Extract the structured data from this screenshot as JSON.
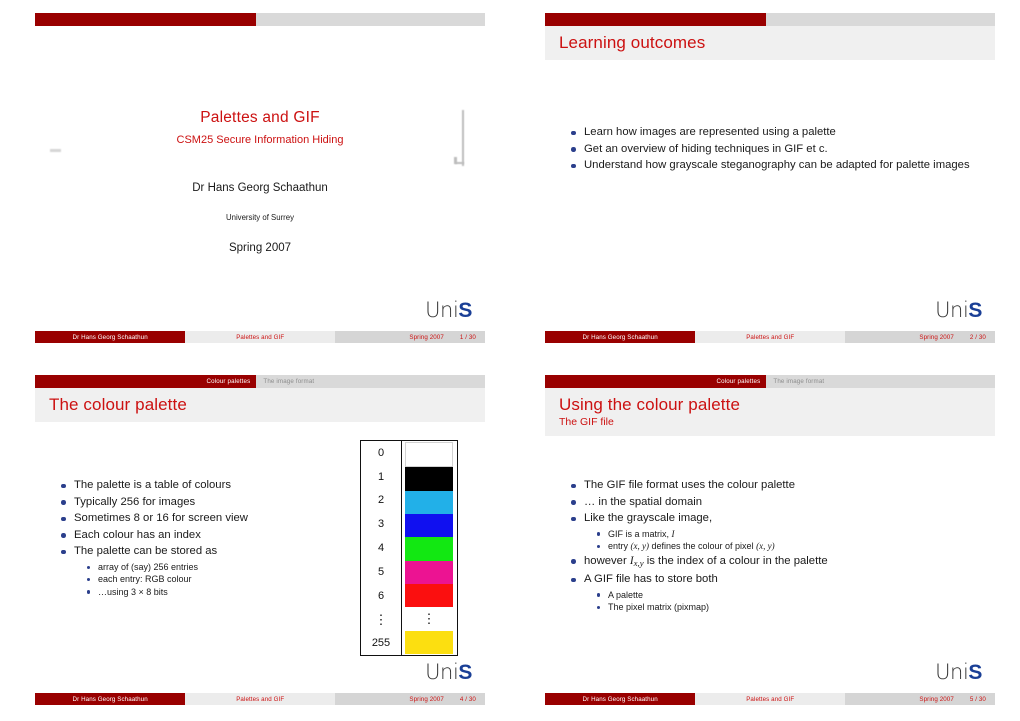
{
  "deck": {
    "author": "Dr Hans Georg Schaathun",
    "short_title": "Palettes and GIF",
    "date": "Spring 2007",
    "total_slides": "30",
    "logo_uni": "Uni",
    "logo_s": "S",
    "accent_red": "#990000",
    "title_red": "#cc1111",
    "bullet_blue": "#2b3f8c",
    "band_gray": "#f0f0f0",
    "nav_gray": "#d9d9d9"
  },
  "slide1": {
    "title": "Palettes and GIF",
    "subtitle": "CSM25 Secure Information Hiding",
    "author": "Dr Hans Georg Schaathun",
    "institute": "University of Surrey",
    "date": "Spring 2007",
    "footer": {
      "author": "Dr Hans Georg Schaathun",
      "title": "Palettes and GIF",
      "date": "Spring 2007",
      "page": "1 / 30"
    }
  },
  "slide2": {
    "title": "Learning outcomes",
    "bullets": [
      "Learn how images are represented using a palette",
      "Get an overview of hiding techniques in GIF et c.",
      "Understand how grayscale steganography can be adapted for palette images"
    ],
    "footer": {
      "author": "Dr Hans Georg Schaathun",
      "title": "Palettes and GIF",
      "date": "Spring 2007",
      "page": "2 / 30"
    }
  },
  "slide3": {
    "nav": {
      "active": "Colour palettes",
      "inactive": "The image format"
    },
    "title": "The colour palette",
    "bullets": [
      "The palette is a table of colours",
      "Typically 256 for images",
      "Sometimes 8 or 16 for screen view",
      "Each colour has an index",
      "The palette can be stored as"
    ],
    "subbullets": [
      "array of (say) 256 entries",
      "each entry: RGB colour",
      "…using 3 × 8 bits"
    ],
    "palette_figure": {
      "indices": [
        "0",
        "1",
        "2",
        "3",
        "4",
        "5",
        "6",
        "⋮",
        "255"
      ],
      "colours": [
        "#ffffff",
        "#000000",
        "#22b0e8",
        "#1010f0",
        "#12e812",
        "#ec1392",
        "#fb0f0f",
        "",
        "#fcdf10"
      ]
    },
    "footer": {
      "author": "Dr Hans Georg Schaathun",
      "title": "Palettes and GIF",
      "date": "Spring 2007",
      "page": "4 / 30"
    }
  },
  "slide4": {
    "nav": {
      "active": "Colour palettes",
      "inactive": "The image format"
    },
    "title": "Using the colour palette",
    "subtitle": "The GIF file",
    "bullets": {
      "b1": "The GIF file format uses the colour palette",
      "b2": "… in the spatial domain",
      "b3": "Like the grayscale image,",
      "b3s1_pre": "GIF is a matrix, ",
      "b3s1_math": "I",
      "b3s2_pre": "entry ",
      "b3s2_xy1": "(x, y)",
      "b3s2_mid": " defines the colour of pixel ",
      "b3s2_xy2": "(x, y)",
      "b4_pre": "however ",
      "b4_sym": "I",
      "b4_sub": "x,y",
      "b4_post": " is the index of a colour in the palette",
      "b5": "A GIF file has to store both",
      "b5s1": "A palette",
      "b5s2": "The pixel matrix (pixmap)"
    },
    "footer": {
      "author": "Dr Hans Georg Schaathun",
      "title": "Palettes and GIF",
      "date": "Spring 2007",
      "page": "5 / 30"
    }
  }
}
